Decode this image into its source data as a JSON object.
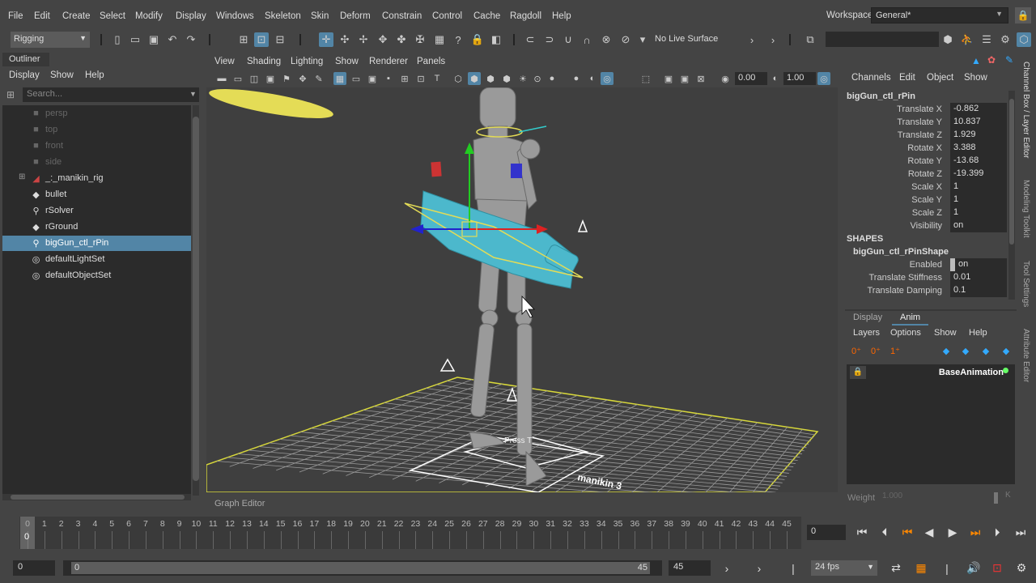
{
  "menubar": {
    "items": [
      "File",
      "Edit",
      "Create",
      "Select",
      "Modify",
      "Display",
      "Windows",
      "Skeleton",
      "Skin",
      "Deform",
      "Constrain",
      "Control",
      "Cache",
      "Ragdoll",
      "Help"
    ],
    "workspace_label": "Workspace:",
    "workspace_value": "General*"
  },
  "shelf": {
    "mode": "Rigging",
    "live_surface": "No Live Surface"
  },
  "outliner": {
    "tab": "Outliner",
    "menu": [
      "Display",
      "Show",
      "Help"
    ],
    "search_placeholder": "Search...",
    "items": [
      {
        "label": "persp",
        "icon": "camera-icon"
      },
      {
        "label": "top",
        "icon": "camera-icon"
      },
      {
        "label": "front",
        "icon": "camera-icon"
      },
      {
        "label": "side",
        "icon": "camera-icon"
      },
      {
        "label": "_:_manikin_rig",
        "icon": "rig-icon"
      },
      {
        "label": "bullet",
        "icon": "node-icon"
      },
      {
        "label": "rSolver",
        "icon": "solver-icon"
      },
      {
        "label": "rGround",
        "icon": "node-icon"
      },
      {
        "label": "bigGun_ctl_rPin",
        "icon": "pin-icon"
      },
      {
        "label": "defaultLightSet",
        "icon": "set-icon"
      },
      {
        "label": "defaultObjectSet",
        "icon": "set-icon"
      }
    ]
  },
  "viewport": {
    "menu": [
      "View",
      "Shading",
      "Lighting",
      "Show",
      "Renderer",
      "Panels"
    ],
    "near_value": "0.00",
    "far_value": "1.00",
    "hud_text": "Press T",
    "floor_label": "manikin 3",
    "graph_editor_label": "Graph Editor"
  },
  "channel_box": {
    "menu": [
      "Channels",
      "Edit",
      "Object",
      "Show"
    ],
    "object": "bigGun_ctl_rPin",
    "channels": [
      {
        "name": "Translate X",
        "value": "-0.862"
      },
      {
        "name": "Translate Y",
        "value": "10.837"
      },
      {
        "name": "Translate Z",
        "value": "1.929"
      },
      {
        "name": "Rotate X",
        "value": "3.388"
      },
      {
        "name": "Rotate Y",
        "value": "-13.68"
      },
      {
        "name": "Rotate Z",
        "value": "-19.399"
      },
      {
        "name": "Scale X",
        "value": "1"
      },
      {
        "name": "Scale Y",
        "value": "1"
      },
      {
        "name": "Scale Z",
        "value": "1"
      },
      {
        "name": "Visibility",
        "value": "on"
      }
    ],
    "shapes_header": "SHAPES",
    "shape_name": "bigGun_ctl_rPinShape",
    "shape_channels": [
      {
        "name": "Enabled",
        "value": "on"
      },
      {
        "name": "Translate Stiffness",
        "value": "0.01"
      },
      {
        "name": "Translate Damping",
        "value": "0.1"
      }
    ]
  },
  "side_tabs": [
    "Channel Box / Layer Editor",
    "Modeling Toolkit",
    "Tool Settings",
    "Attribute Editor"
  ],
  "layer_editor": {
    "tabs": [
      "Display",
      "Anim"
    ],
    "menu": [
      "Layers",
      "Options",
      "Show",
      "Help"
    ],
    "layer_name": "BaseAnimation",
    "weight_label": "Weight",
    "weight_value": "1.000"
  },
  "timeline": {
    "ticks": [
      "0",
      "1",
      "2",
      "3",
      "4",
      "5",
      "6",
      "7",
      "8",
      "9",
      "10",
      "11",
      "12",
      "13",
      "14",
      "15",
      "16",
      "17",
      "18",
      "19",
      "20",
      "21",
      "22",
      "23",
      "24",
      "25",
      "26",
      "27",
      "28",
      "29",
      "30",
      "31",
      "32",
      "33",
      "34",
      "35",
      "36",
      "37",
      "38",
      "39",
      "40",
      "41",
      "42",
      "43",
      "44",
      "45"
    ],
    "current": "0",
    "current_field": "0"
  },
  "range": {
    "start": "0",
    "inner_start": "0",
    "inner_end": "45",
    "end": "45",
    "fps": "24 fps"
  }
}
